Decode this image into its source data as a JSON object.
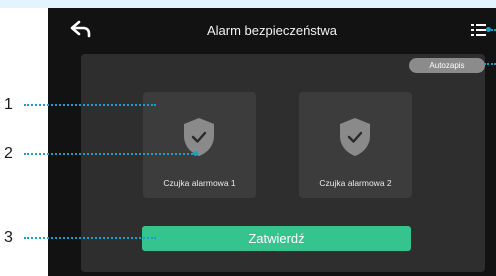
{
  "header": {
    "title": "Alarm bezpieczeństwa",
    "back_icon": "back-arrow-icon",
    "menu_icon": "list-menu-icon"
  },
  "panel": {
    "autosave_label": "Autozapis",
    "sensors": [
      {
        "label": "Czujka alarmowa 1",
        "icon": "shield-check-icon"
      },
      {
        "label": "Czujka alarmowa 2",
        "icon": "shield-check-icon"
      }
    ],
    "confirm_label": "Zatwierdź"
  },
  "callouts": {
    "one": "1",
    "two": "2",
    "three": "3"
  },
  "colors": {
    "screen_bg": "#121212",
    "panel_bg": "#2e2e2e",
    "card_bg": "#3c3c3c",
    "accent_green": "#35c38e",
    "callout_line": "#17a2c4"
  }
}
